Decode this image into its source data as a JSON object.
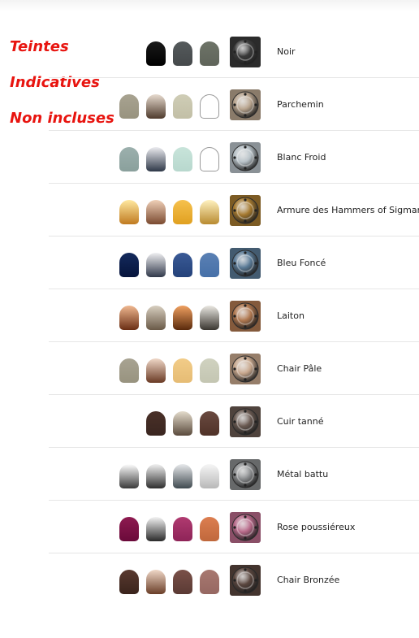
{
  "note": {
    "lines": [
      "Teintes",
      "Indicatives",
      "Non incluses"
    ],
    "color": "#e8140f"
  },
  "rows": [
    {
      "name": "Noir",
      "thumb": "#3a3a3a",
      "pots": [
        {
          "top": "#1a1a1a",
          "bottom": "#000000"
        },
        {
          "top": "#555a5c",
          "bottom": "#45494b"
        },
        {
          "top": "#6e7468",
          "bottom": "#5f645a"
        }
      ]
    },
    {
      "name": "Parchemin",
      "thumb": "#b8a48e",
      "pots": [
        {
          "top": "#a8a391",
          "bottom": "#98937f"
        },
        {
          "top": "#e8dcd0",
          "bottom": "#4e3a2c"
        },
        {
          "top": "#cfcdb6",
          "bottom": "#c2bfa6"
        },
        "empty"
      ]
    },
    {
      "name": "Blanc Froid",
      "thumb": "#b8c2c8",
      "pots": [
        {
          "top": "#9cb0ad",
          "bottom": "#8aa09c"
        },
        {
          "top": "#ececf0",
          "bottom": "#2e3848"
        },
        {
          "top": "#c8e4da",
          "bottom": "#b8d8ce"
        },
        "empty"
      ]
    },
    {
      "name": "Armure des Hammers of Sigmar",
      "thumb": "#a67a30",
      "pots": [
        {
          "top": "#ffe9a0",
          "bottom": "#c07a20"
        },
        {
          "top": "#f0d0b8",
          "bottom": "#7a4a30"
        },
        {
          "top": "#f6c14e",
          "bottom": "#e0a020"
        },
        {
          "top": "#fff2c0",
          "bottom": "#b88a30"
        }
      ]
    },
    {
      "name": "Bleu Foncé",
      "thumb": "#5a7a96",
      "pots": [
        {
          "top": "#142a5c",
          "bottom": "#06143c"
        },
        {
          "top": "#f0f0f2",
          "bottom": "#30384a"
        },
        {
          "top": "#3a5a96",
          "bottom": "#24427a"
        },
        {
          "top": "#5a80b4",
          "bottom": "#4670a8"
        }
      ]
    },
    {
      "name": "Laiton",
      "thumb": "#b07850",
      "pots": [
        {
          "top": "#f0b890",
          "bottom": "#6a2e14"
        },
        {
          "top": "#d8cfc0",
          "bottom": "#6a5a48"
        },
        {
          "top": "#f0a060",
          "bottom": "#5a2a0c"
        },
        {
          "top": "#eae8e2",
          "bottom": "#3a3630"
        }
      ]
    },
    {
      "name": "Chair Pâle",
      "thumb": "#c8a88e",
      "pots": [
        {
          "top": "#a8a392",
          "bottom": "#98937f"
        },
        {
          "top": "#f0d8c8",
          "bottom": "#6a3a24"
        },
        {
          "top": "#f2cc88",
          "bottom": "#e6bc74"
        },
        {
          "top": "#d0d2c0",
          "bottom": "#c4c6b2"
        }
      ]
    },
    {
      "name": "Cuir tanné",
      "thumb": "#6a5a52",
      "pots": [
        {
          "top": "#4a3028",
          "bottom": "#3a2620"
        },
        {
          "top": "#e4dccc",
          "bottom": "#5a4a3c"
        },
        {
          "top": "#6a4a40",
          "bottom": "#503228"
        }
      ]
    },
    {
      "name": "Métal battu",
      "thumb": "#8a8c8e",
      "pots": [
        {
          "top": "#ffffff",
          "bottom": "#3a3a3a"
        },
        {
          "top": "#f2f2f2",
          "bottom": "#2e2e2e"
        },
        {
          "top": "#e8eaec",
          "bottom": "#404a50"
        },
        {
          "top": "#f6f6f6",
          "bottom": "#b8b8b8"
        }
      ]
    },
    {
      "name": "Rose poussiéreux",
      "thumb": "#b86a8a",
      "pots": [
        {
          "top": "#8e1a50",
          "bottom": "#6a0a3a"
        },
        {
          "top": "#f4f4f4",
          "bottom": "#2a2a2a"
        },
        {
          "top": "#b03a70",
          "bottom": "#8e2458"
        },
        {
          "top": "#dc7e50",
          "bottom": "#c0683c"
        }
      ]
    },
    {
      "name": "Chair Bronzée",
      "thumb": "#5a463e",
      "pots": [
        {
          "top": "#5a3a30",
          "bottom": "#3a241c"
        },
        {
          "top": "#f0d8c8",
          "bottom": "#6a3e28"
        },
        {
          "top": "#7a5048",
          "bottom": "#5a3a34"
        },
        {
          "top": "#a87870",
          "bottom": "#966862"
        }
      ]
    }
  ]
}
